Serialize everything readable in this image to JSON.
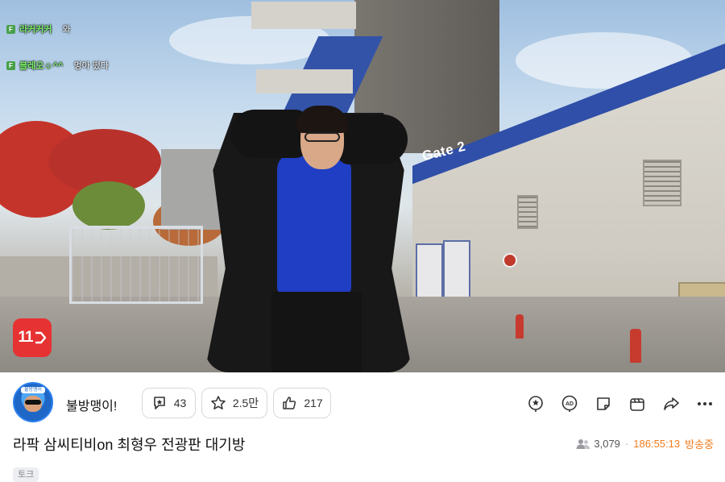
{
  "chat": [
    {
      "user": "라커커커",
      "message": "와"
    },
    {
      "user": "블레오☺^^",
      "message": "멍아 떴다"
    }
  ],
  "video": {
    "gate_sign": "Gate 2",
    "platform_logo": "11"
  },
  "channel": {
    "name": "불방맹이!",
    "avatar_tag": "불방맹이"
  },
  "actions": {
    "ad_balloon_count": "43",
    "favorite_count": "2.5만",
    "like_count": "217"
  },
  "toolbar_icons": [
    "ranking-icon",
    "ad-icon",
    "sticker-icon",
    "clip-icon",
    "share-icon",
    "more-icon"
  ],
  "broadcast": {
    "title": "라팍 삼씨티비on 최형우 전광판 대기방",
    "viewers": "3,079",
    "uptime": "186:55:13",
    "live_label": "방송중",
    "category_tag": "토크"
  },
  "colors": {
    "accent_orange": "#f07c1f",
    "logo_red": "#e63232",
    "avatar_blue": "#2a7ff0"
  }
}
